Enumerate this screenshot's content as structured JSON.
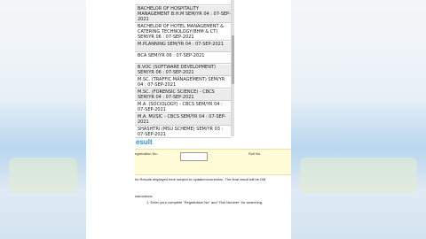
{
  "courses": [
    "BACHELOR OF HOSPITALITY MANAGEMENT B.H.M SEM/YR 04 : 07-SEP-2021",
    "BACHELOR OF HOTEL MANAGEMENT & CATERING TECHNOLOGY(BHM & CT) SEM/YR 06 : 07-SEP-2021",
    "M.PLANNING SEM/YR 04 : 07-SEP-2021",
    "BCA SEM/YR 06 : 07-SEP-2021",
    "B.VOC (SOFTWARE DEVELOPMENT) SEM/YR 06 : 07-SEP-2021",
    "M.SC. (TRAFFIC MANAGEMENT) SEM/YR 04 : 07-SEP-2021",
    "M.SC. (FORENSIC SCIENCE) - CBCS SEM/YR 04 : 07-SEP-2021",
    "M.A. (SOCIOLOGY) - CBCS SEM/YR 04 : 07-SEP-2021",
    "M.A. MUSIC - CBCS SEM/YR 04 : 07-SEP-2021",
    "SHASHTRI (MSU SCHEME) SEM/YR 03 : 07-SEP-2021"
  ],
  "result": {
    "title": "esult",
    "registration_label": "egistration No.",
    "registration_value": "",
    "roll_label": "Roll No.",
    "note": "he Results displayed here subject to updation/correction. The final result will be DM",
    "instructions_title": "nstructions:",
    "instruction_1": "1. Enter your complete \"Registration No\" and \"Roll Number\" for searching."
  }
}
